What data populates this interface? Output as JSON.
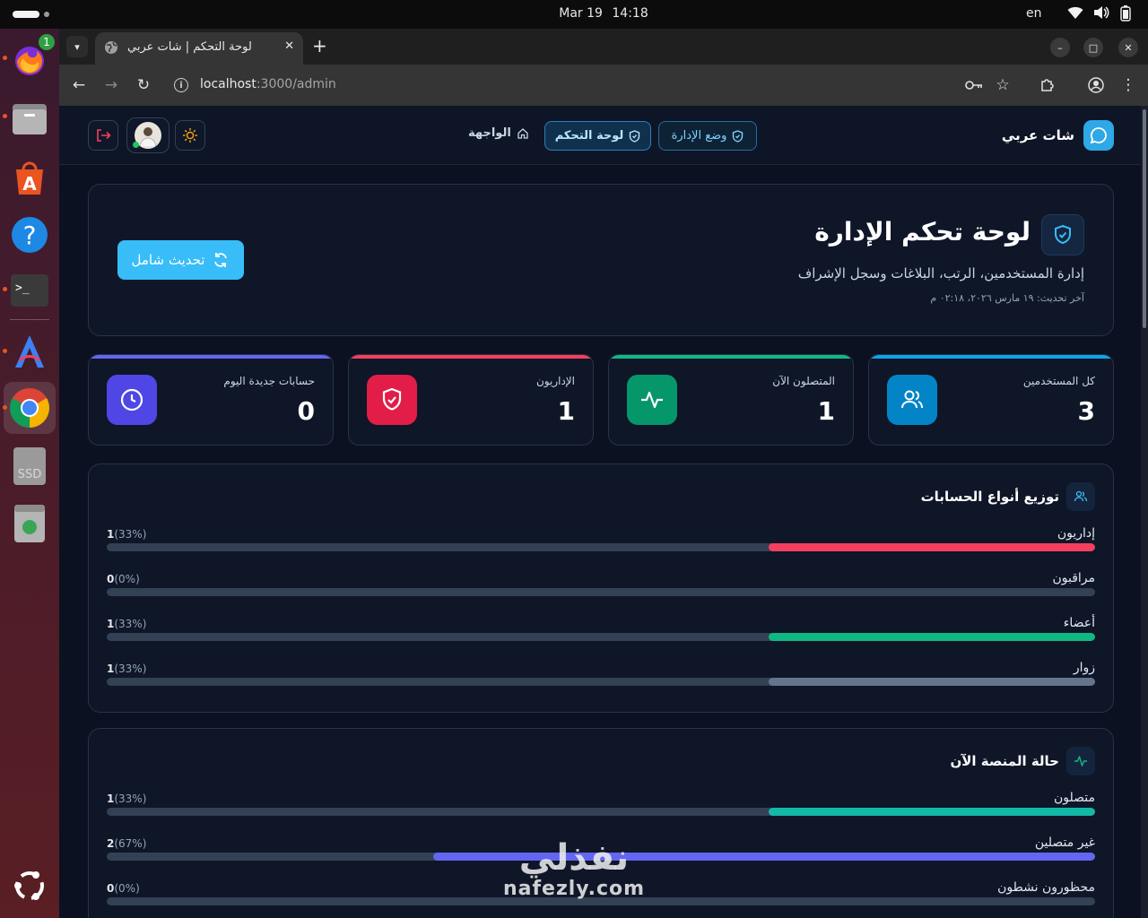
{
  "os": {
    "date": "Mar 19",
    "time": "14:18",
    "language": "en"
  },
  "dock": {
    "items": [
      "firefox-icon",
      "files-icon",
      "app-center-icon",
      "help-icon",
      "terminal-icon",
      "arc-editor-icon",
      "chrome-icon",
      "ssd-drive-icon",
      "trash-icon",
      "ubuntu-apps-icon"
    ],
    "firefox_badge": "1",
    "ssd_label": "SSD"
  },
  "browser": {
    "tab_title": "لوحة التحكم | شات عربي",
    "url_host": "localhost",
    "url_path": ":3000/admin"
  },
  "header": {
    "brand": "شات عربي",
    "admin_mode": "وضع الإدارة",
    "dashboard": "لوحة التحكم",
    "interface": "الواجهة"
  },
  "hero": {
    "title": "لوحة تحكم الإدارة",
    "subtitle": "إدارة المستخدمين، الرتب، البلاغات وسجل الإشراف",
    "updated": "آخر تحديث: ١٩ مارس ٢٠٢٦، ٠٢:١٨ م",
    "refresh_label": "تحديث شامل"
  },
  "stats": [
    {
      "label": "كل المستخدمين",
      "value": "3",
      "color": "#0284c7",
      "topline": "#0ea5e9"
    },
    {
      "label": "المتصلون الآن",
      "value": "1",
      "color": "#059669",
      "topline": "#10b981"
    },
    {
      "label": "الإداريون",
      "value": "1",
      "color": "#e11d48",
      "topline": "#f43f5e"
    },
    {
      "label": "حسابات جديدة اليوم",
      "value": "0",
      "color": "#4f46e5",
      "topline": "#6366f1"
    }
  ],
  "account_distribution": {
    "title": "توزيع أنواع الحسابات",
    "rows": [
      {
        "label": "إداريون",
        "count": "1",
        "pct": "(33%)",
        "fraction": 0.33,
        "color": "#f43f5e"
      },
      {
        "label": "مراقبون",
        "count": "0",
        "pct": "(0%)",
        "fraction": 0,
        "color": "#f59e0b"
      },
      {
        "label": "أعضاء",
        "count": "1",
        "pct": "(33%)",
        "fraction": 0.33,
        "color": "#10b981"
      },
      {
        "label": "زوار",
        "count": "1",
        "pct": "(33%)",
        "fraction": 0.33,
        "color": "#64748b"
      }
    ]
  },
  "platform_status": {
    "title": "حالة المنصة الآن",
    "rows": [
      {
        "label": "متصلون",
        "count": "1",
        "pct": "(33%)",
        "fraction": 0.33,
        "color": "#14b8a6"
      },
      {
        "label": "غير متصلين",
        "count": "2",
        "pct": "(67%)",
        "fraction": 0.67,
        "color": "#6366f1"
      },
      {
        "label": "محظورون نشطون",
        "count": "0",
        "pct": "(0%)",
        "fraction": 0,
        "color": "#ef4444"
      }
    ]
  },
  "watermark": {
    "arabic": "نفذلي",
    "latin": "nafezly.com"
  }
}
